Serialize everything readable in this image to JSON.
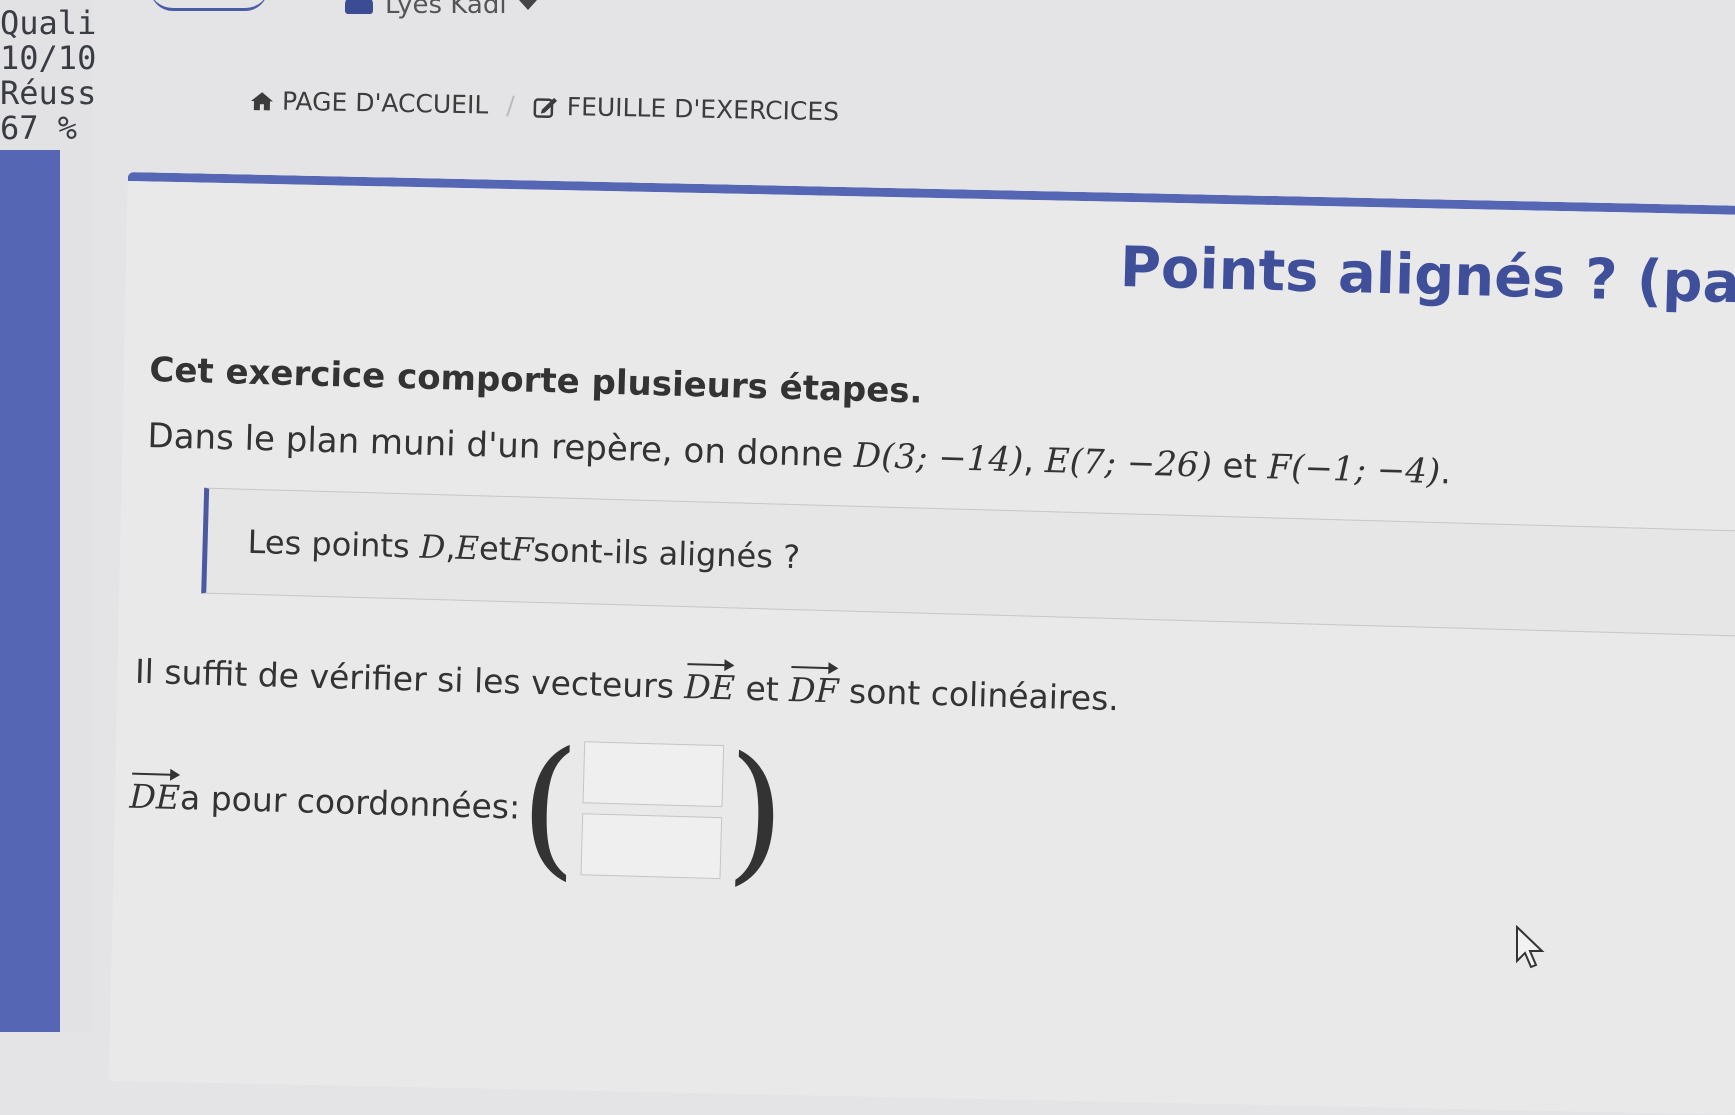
{
  "sidebar": {
    "stats": [
      "Qualité",
      "10/10",
      "Réussi",
      "67 %"
    ]
  },
  "header": {
    "user_name": "Lyes Kadi"
  },
  "breadcrumb": {
    "home_label": "PAGE D'ACCUEIL",
    "separator": "/",
    "exercises_label": "FEUILLE D'EXERCICES"
  },
  "exercise": {
    "title": "Points alignés ? (par",
    "intro": "Cet exercice comporte plusieurs étapes.",
    "statement_prefix": "Dans le plan muni d'un repère, on donne ",
    "point_d": "D(3; −14)",
    "comma": ", ",
    "point_e": "E(7; −26)",
    "and_word": " et ",
    "point_f": "F(−1; −4)",
    "period": ".",
    "question": {
      "prefix": "Les points ",
      "d": "D",
      "sep": ", ",
      "e": "E",
      "and_word": " et ",
      "f": "F",
      "suffix": " sont-ils alignés ?"
    },
    "hint": {
      "prefix": "Il suffit de vérifier si les vecteurs ",
      "vec1": "DE",
      "and_word": " et ",
      "vec2": "DF",
      "suffix": " sont colinéaires."
    },
    "coordinates": {
      "vec": "DE",
      "label": " a pour coordonnées:",
      "x_value": "",
      "y_value": "",
      "open_paren": "(",
      "close_paren": ")"
    }
  },
  "colors": {
    "accent": "#5566b4",
    "title": "#3f4f9a"
  }
}
